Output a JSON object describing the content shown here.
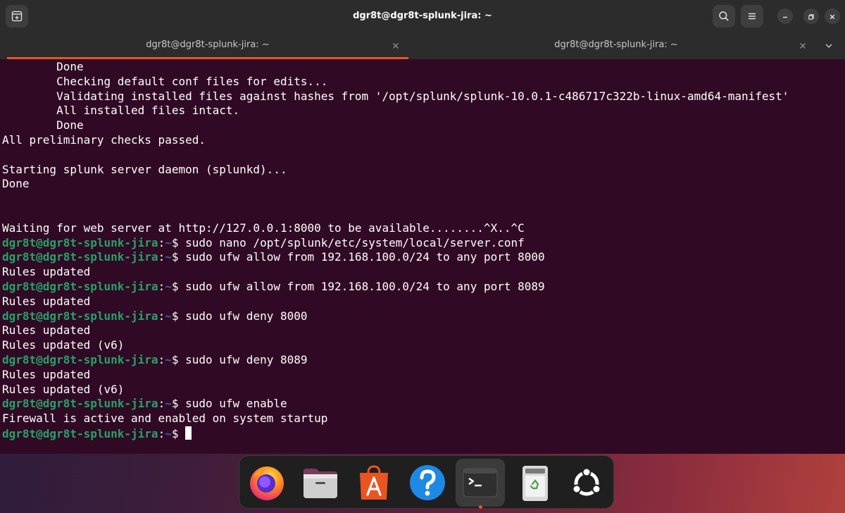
{
  "window": {
    "title": "dgr8t@dgr8t-splunk-jira: ~"
  },
  "titlebar_icons": {
    "new_tab": "new-tab-icon",
    "search": "search-icon",
    "menu": "hamburger-menu-icon",
    "minimize": "minimize-icon",
    "maximize": "maximize-icon",
    "close": "close-icon"
  },
  "tabs": [
    {
      "label": "dgr8t@dgr8t-splunk-jira: ~",
      "active": true
    },
    {
      "label": "dgr8t@dgr8t-splunk-jira: ~",
      "active": false
    }
  ],
  "colors": {
    "terminal_bg": "#300a24",
    "prompt_user": "#26a269",
    "prompt_path": "#3465a4",
    "accent": "#e95420",
    "titlebar_bg": "#2c2c2c"
  },
  "terminal": {
    "lines": [
      "        Done",
      "        Checking default conf files for edits...",
      "        Validating installed files against hashes from '/opt/splunk/splunk-10.0.1-c486717c322b-linux-amd64-manifest'",
      "        All installed files intact.",
      "        Done",
      "All preliminary checks passed.",
      "",
      "Starting splunk server daemon (splunkd)...",
      "Done",
      "",
      "",
      "Waiting for web server at http://127.0.0.1:8000 to be available........^X..^C"
    ],
    "prompt": {
      "user_host": "dgr8t@dgr8t-splunk-jira",
      "colon": ":",
      "path": "~",
      "symbol": "$ "
    },
    "session": [
      {
        "command": "sudo nano /opt/splunk/etc/system/local/server.conf",
        "output": []
      },
      {
        "command": "sudo ufw allow from 192.168.100.0/24 to any port 8000",
        "output": [
          "Rules updated"
        ]
      },
      {
        "command": "sudo ufw allow from 192.168.100.0/24 to any port 8089",
        "output": [
          "Rules updated"
        ]
      },
      {
        "command": "sudo ufw deny 8000",
        "output": [
          "Rules updated",
          "Rules updated (v6)"
        ]
      },
      {
        "command": "sudo ufw deny 8089",
        "output": [
          "Rules updated",
          "Rules updated (v6)"
        ]
      },
      {
        "command": "sudo ufw enable",
        "output": [
          "Firewall is active and enabled on system startup"
        ]
      },
      {
        "command": "",
        "output": []
      }
    ]
  },
  "dock": {
    "items": [
      {
        "name": "firefox",
        "icon": "firefox-icon",
        "running": false
      },
      {
        "name": "files",
        "icon": "files-folder-icon",
        "running": false
      },
      {
        "name": "app-center",
        "icon": "app-center-icon",
        "running": false
      },
      {
        "name": "help",
        "icon": "help-icon",
        "running": false
      },
      {
        "name": "terminal",
        "icon": "terminal-icon",
        "running": true
      },
      {
        "name": "trash",
        "icon": "trash-icon",
        "running": false
      },
      {
        "name": "show-apps",
        "icon": "ubuntu-logo-icon",
        "running": false
      }
    ]
  }
}
